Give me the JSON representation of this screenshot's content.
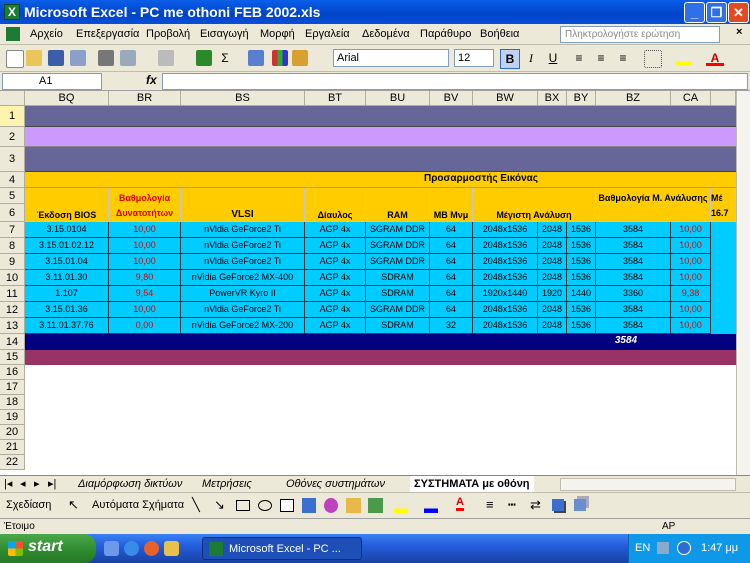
{
  "window": {
    "title": "Microsoft Excel - PC me othoni FEB 2002.xls"
  },
  "menu": [
    "Αρχείο",
    "Επεξεργασία",
    "Προβολή",
    "Εισαγωγή",
    "Μορφή",
    "Εργαλεία",
    "Δεδομένα",
    "Παράθυρο",
    "Βοήθεια"
  ],
  "help_placeholder": "Πληκτρολογήστε ερώτηση",
  "font": {
    "name": "Arial",
    "size": "12"
  },
  "formula": {
    "cell_ref": "A1",
    "fx": "fx"
  },
  "columns": [
    "BQ",
    "BR",
    "BS",
    "BT",
    "BU",
    "BV",
    "BW",
    "BX",
    "BY",
    "BZ",
    "CA"
  ],
  "rows": [
    "1",
    "2",
    "3",
    "4",
    "5",
    "6",
    "7",
    "8",
    "9",
    "10",
    "11",
    "12",
    "13",
    "14",
    "15",
    "16",
    "17",
    "18",
    "19",
    "20",
    "21",
    "22"
  ],
  "sheet": {
    "group_header": "Προσαρμοστής Εικόνας",
    "headers": {
      "bios": "Έκδοση BIOS",
      "score1": "Βαθμολογία Δυνατοτήτων",
      "vlsi": "VLSI",
      "bus": "Δίαυλος",
      "ram": "RAM",
      "mb": "MB Μνμ",
      "maxres": "Μέγιστη Ανάλυση",
      "score2": "Βαθμολογία Μ. Ανάλυσης",
      "extra": "Μέ 16.7"
    },
    "data": [
      [
        "3.15.0104",
        "10,00",
        "nVidia GeForce2 Ti",
        "AGP 4x",
        "SGRAM DDR",
        "64",
        "2048x1536",
        "2048",
        "1536",
        "3584",
        "10,00"
      ],
      [
        "3.15.01.02.12",
        "10,00",
        "nVidia GeForce2 Ti",
        "AGP 4x",
        "SGRAM DDR",
        "64",
        "2048x1536",
        "2048",
        "1536",
        "3584",
        "10,00"
      ],
      [
        "3.15.01.04",
        "10,00",
        "nVidia GeForce2 Ti",
        "AGP 4x",
        "SGRAM DDR",
        "64",
        "2048x1536",
        "2048",
        "1536",
        "3584",
        "10,00"
      ],
      [
        "3.11.01.30",
        "9,80",
        "nVidia GeForce2 MX-400",
        "AGP 4x",
        "SDRAM",
        "64",
        "2048x1536",
        "2048",
        "1536",
        "3584",
        "10,00"
      ],
      [
        "1.107",
        "9,54",
        "PowerVR Kyro II",
        "AGP 4x",
        "SDRAM",
        "64",
        "1920x1440",
        "1920",
        "1440",
        "3360",
        "9,38"
      ],
      [
        "3.15.01.36",
        "10,00",
        "nVidia GeForce2 Ti",
        "AGP 4x",
        "SGRAM DDR",
        "64",
        "2048x1536",
        "2048",
        "1536",
        "3584",
        "10,00"
      ],
      [
        "3.11.01.37.76",
        "0,00",
        "nVidia GeForce2 MX-200",
        "AGP 4x",
        "SDRAM",
        "32",
        "2048x1536",
        "2048",
        "1536",
        "3584",
        "10,00"
      ]
    ],
    "total": "3584"
  },
  "tabs": [
    "Διαμόρφωση δικτύων",
    "Μετρήσεις",
    "Οθόνες συστημάτων",
    "ΣΥΣΤΗΜΑΤΑ με οθόνη"
  ],
  "drawing": {
    "draw_label": "Σχεδίαση",
    "autoshapes_label": "Αυτόματα Σχήματα"
  },
  "status": {
    "left": "Έτοιμο",
    "right": "ΑΡ"
  },
  "taskbar": {
    "start": "start",
    "item": "Microsoft Excel - PC ...",
    "lang": "EN",
    "clock": "1:47 μμ"
  }
}
